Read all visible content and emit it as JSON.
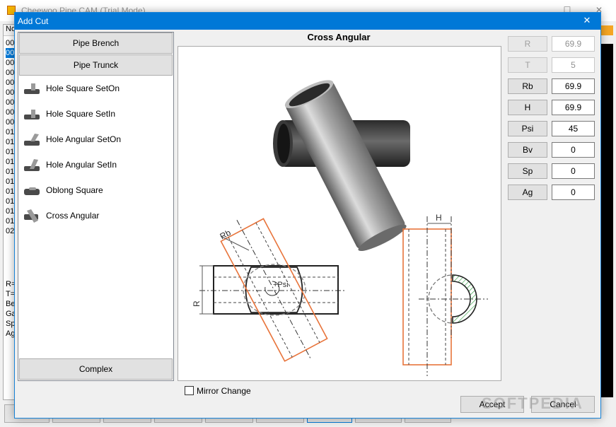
{
  "background_window": {
    "title": "Cheewoo Pipe CAM (Trial Mode)",
    "list_header": "No",
    "rows": [
      "00",
      "00",
      "00",
      "00",
      "00",
      "00",
      "00",
      "00",
      "00",
      "01",
      "01",
      "01",
      "01",
      "01",
      "01",
      "01",
      "01",
      "01",
      "01",
      "02"
    ],
    "selected_row_index": 1,
    "info_lines": [
      "R=",
      "T=",
      "Be",
      "Ga",
      "Sp",
      "Ag"
    ]
  },
  "dialog": {
    "title": "Add Cut",
    "close_glyph": "✕"
  },
  "left_panel": {
    "category_buttons": {
      "branch": "Pipe Brench",
      "trunk": "Pipe Trunck",
      "complex": "Complex"
    },
    "cut_items": [
      {
        "label": "Hole Square SetOn",
        "icon": "pipe-hole-square-seton-icon"
      },
      {
        "label": "Hole Square SetIn",
        "icon": "pipe-hole-square-setin-icon"
      },
      {
        "label": "Hole Angular SetOn",
        "icon": "pipe-hole-angular-seton-icon"
      },
      {
        "label": "Hole Angular SetIn",
        "icon": "pipe-hole-angular-setin-icon"
      },
      {
        "label": "Oblong Square",
        "icon": "pipe-oblong-square-icon"
      },
      {
        "label": "Cross Angular",
        "icon": "pipe-cross-angular-icon"
      }
    ]
  },
  "preview": {
    "title": "Cross Angular",
    "labels": {
      "rb": "Rb",
      "r": "R",
      "psi": "+Psi",
      "h": "H"
    }
  },
  "parameters": [
    {
      "name": "R",
      "value": "69.9",
      "enabled": false
    },
    {
      "name": "T",
      "value": "5",
      "enabled": false
    },
    {
      "name": "Rb",
      "value": "69.9",
      "enabled": true
    },
    {
      "name": "H",
      "value": "69.9",
      "enabled": true
    },
    {
      "name": "Psi",
      "value": "45",
      "enabled": true
    },
    {
      "name": "Bv",
      "value": "0",
      "enabled": true
    },
    {
      "name": "Sp",
      "value": "0",
      "enabled": true
    },
    {
      "name": "Ag",
      "value": "0",
      "enabled": true
    }
  ],
  "bottom": {
    "mirror_label": "Mirror Change",
    "mirror_checked": false,
    "accept_label": "Accept",
    "cancel_label": "Cancel"
  },
  "watermark": "SOFTPEDIA",
  "colors": {
    "title_bar": "#0078d7",
    "cut_outline": "#e8743b",
    "pipe_outline": "#222222",
    "hatch": "#2e9b3e"
  }
}
